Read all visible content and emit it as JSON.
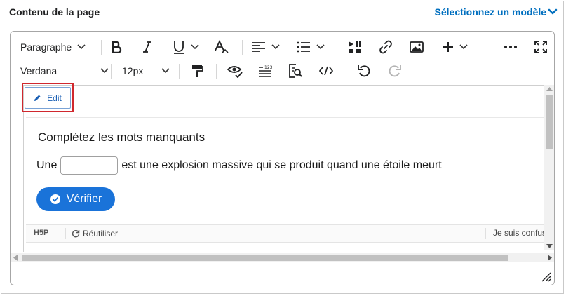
{
  "header": {
    "title": "Contenu de la page",
    "template_link": "Sélectionnez un modèle"
  },
  "toolbar": {
    "block_format": "Paragraphe",
    "font_family": "Verdana",
    "font_size": "12px"
  },
  "edit_button": {
    "label": "Edit"
  },
  "h5p": {
    "title": "Complétez les mots manquants",
    "sentence_before": "Une",
    "sentence_after": "est une explosion massive qui se produit quand une étoile meurt",
    "blank_value": "",
    "check_label": "Vérifier",
    "footer": {
      "logo": "H5P",
      "reuse_label": "Réutiliser",
      "confused_label": "Je suis confus"
    }
  },
  "colors": {
    "accent": "#006fbf",
    "check_button": "#1a73d9",
    "highlight": "#d0282e"
  }
}
